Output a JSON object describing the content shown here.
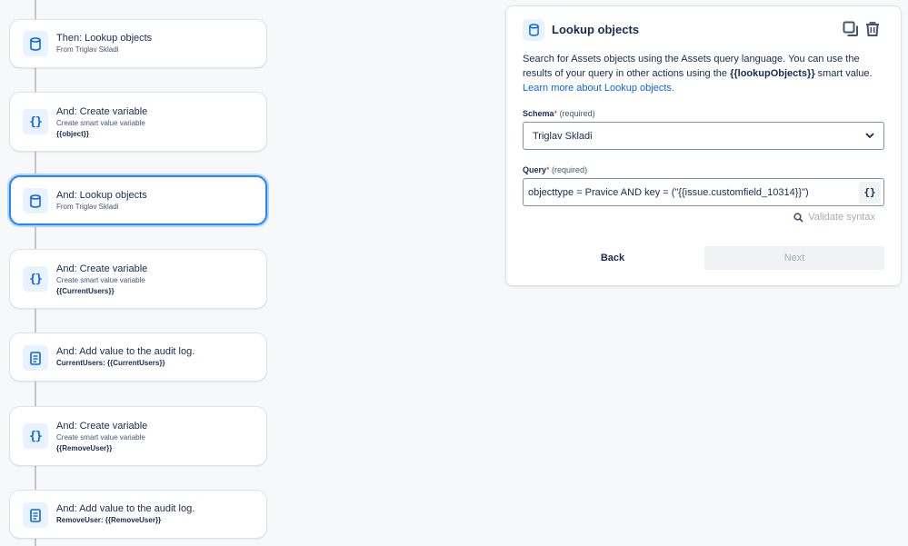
{
  "flow": {
    "steps": [
      {
        "icon": "database-icon",
        "title": "Then: Lookup objects",
        "subtitle": "From Triglav Skladi",
        "detail": ""
      },
      {
        "icon": "braces-icon",
        "title": "And: Create variable",
        "subtitle": "Create smart value variable",
        "detail": "{{object}}"
      },
      {
        "icon": "database-icon",
        "title": "And: Lookup objects",
        "subtitle": "From Triglav Skladi",
        "detail": ""
      },
      {
        "icon": "braces-icon",
        "title": "And: Create variable",
        "subtitle": "Create smart value variable",
        "detail": "{{CurrentUsers}}"
      },
      {
        "icon": "document-icon",
        "title": "And: Add value to the audit log.",
        "subtitle": "",
        "detail": "CurrentUsers: {{CurrentUsers}}"
      },
      {
        "icon": "braces-icon",
        "title": "And: Create variable",
        "subtitle": "Create smart value variable",
        "detail": "{{RemoveUser}}"
      },
      {
        "icon": "document-icon",
        "title": "And: Add value to the audit log.",
        "subtitle": "",
        "detail": "RemoveUser: {{RemoveUser}}"
      }
    ],
    "braces_glyph": "{}"
  },
  "panel": {
    "title": "Lookup objects",
    "description_pre": "Search for Assets objects using the Assets query language. You can use the results of your query in other actions using the ",
    "description_code": "{{lookupObjects}}",
    "description_post": " smart value.",
    "learn_more": "Learn more about Lookup objects.",
    "schema": {
      "label": "Schema",
      "required_star": "*",
      "required_text": "(required)",
      "value": "Triglav Skladi"
    },
    "query": {
      "label": "Query",
      "required_star": "*",
      "required_text": "(required)",
      "value": "objecttype = Pravice AND key = (\"{{issue.customfield_10314}}\")",
      "smart_value_button": "{}"
    },
    "validate_label": "Validate syntax",
    "back_label": "Back",
    "next_label": "Next"
  },
  "colors": {
    "accent": "#0c66e4",
    "selected_border": "#2684ff",
    "icon_bg": "#e9f2ff",
    "connector": "#c1c7d0",
    "disabled_text": "#a5adba"
  }
}
